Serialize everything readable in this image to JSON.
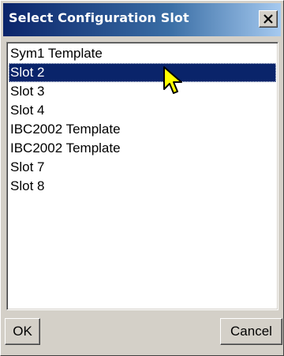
{
  "window": {
    "title": "Select Configuration Slot"
  },
  "slots": [
    {
      "label": "Sym1 Template",
      "selected": false
    },
    {
      "label": "Slot 2",
      "selected": true
    },
    {
      "label": "Slot 3",
      "selected": false
    },
    {
      "label": "Slot 4",
      "selected": false
    },
    {
      "label": "IBC2002 Template",
      "selected": false
    },
    {
      "label": "IBC2002 Template",
      "selected": false
    },
    {
      "label": "Slot 7",
      "selected": false
    },
    {
      "label": "Slot 8",
      "selected": false
    }
  ],
  "buttons": {
    "ok_label": "OK",
    "cancel_label": "Cancel"
  },
  "icons": {
    "close": "close-icon",
    "cursor": "mouse-pointer-icon"
  },
  "colors": {
    "title_bar": "#0a246a",
    "selection": "#0a246a",
    "dialog_face": "#d4d0c8"
  }
}
